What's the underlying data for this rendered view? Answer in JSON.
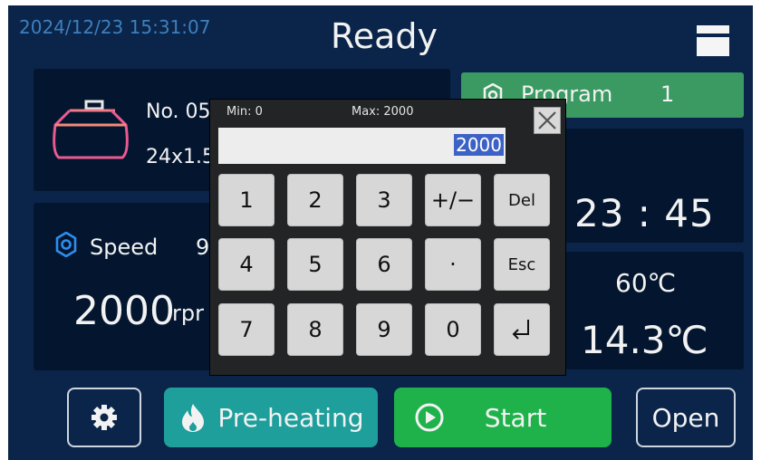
{
  "status_bar": {
    "datetime": "2024/12/23 15:31:07",
    "title": "Ready"
  },
  "sample": {
    "number": "No. 05",
    "size": "24x1.5"
  },
  "program": {
    "label": "Program",
    "number": "1"
  },
  "speed": {
    "label": "Speed",
    "setting": "9",
    "rpm_value": "2000",
    "rpm_unit": "rpr"
  },
  "timer": {
    "value": "23 : 45"
  },
  "temperature": {
    "set_value": "60℃",
    "current_value": "14.3℃"
  },
  "bottom_bar": {
    "preheat_label": "Pre-heating",
    "start_label": "Start",
    "open_label": "Open"
  },
  "keypad": {
    "min_label": "Min: 0",
    "max_label": "Max: 2000",
    "value": "2000",
    "keys": [
      "1",
      "2",
      "3",
      "+/−",
      "Del",
      "4",
      "5",
      "6",
      "·",
      "Esc",
      "7",
      "8",
      "9",
      "0"
    ]
  },
  "colors": {
    "background": "#0a2549",
    "panel": "#04162f",
    "program_green": "#3b9a62",
    "preheat_teal": "#1e9f9b",
    "start_green": "#1fb24b",
    "dialog": "#222426",
    "key": "#d7d7d7",
    "selection": "#3d62c6"
  },
  "icons": {
    "menu": "menu-icon",
    "bag": "sample-bag-icon",
    "program": "gear-icon",
    "speed": "gear-icon",
    "settings": "settings-gear-icon",
    "preheat": "flame-icon",
    "start": "play-circle-icon",
    "close": "close-icon",
    "enter": "enter-return-icon"
  }
}
